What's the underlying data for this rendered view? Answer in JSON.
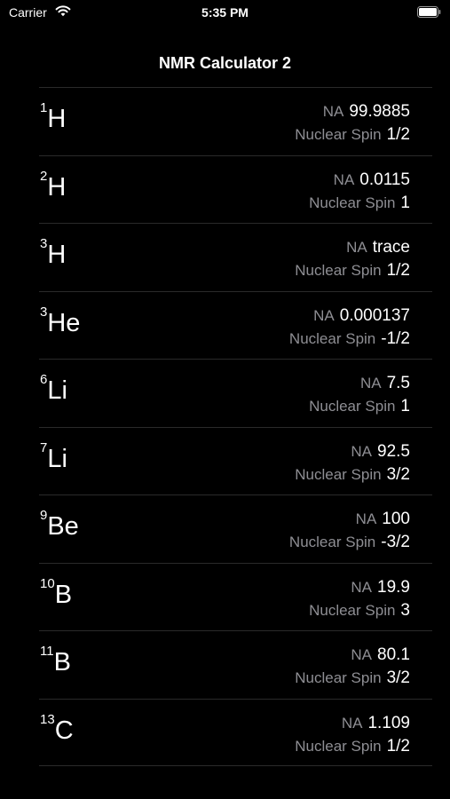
{
  "status_bar": {
    "carrier": "Carrier",
    "time": "5:35 PM",
    "wifi_icon": "wifi-icon",
    "battery_icon": "battery-icon"
  },
  "nav": {
    "title": "NMR Calculator 2"
  },
  "labels": {
    "na": "NA",
    "spin": "Nuclear Spin"
  },
  "isotopes": [
    {
      "mass": "1",
      "symbol": "H",
      "na": "99.9885",
      "spin": "1/2"
    },
    {
      "mass": "2",
      "symbol": "H",
      "na": "0.0115",
      "spin": "1"
    },
    {
      "mass": "3",
      "symbol": "H",
      "na": "trace",
      "spin": "1/2"
    },
    {
      "mass": "3",
      "symbol": "He",
      "na": "0.000137",
      "spin": "-1/2"
    },
    {
      "mass": "6",
      "symbol": "Li",
      "na": "7.5",
      "spin": "1"
    },
    {
      "mass": "7",
      "symbol": "Li",
      "na": "92.5",
      "spin": "3/2"
    },
    {
      "mass": "9",
      "symbol": "Be",
      "na": "100",
      "spin": "-3/2"
    },
    {
      "mass": "10",
      "symbol": "B",
      "na": "19.9",
      "spin": "3"
    },
    {
      "mass": "11",
      "symbol": "B",
      "na": "80.1",
      "spin": "3/2"
    },
    {
      "mass": "13",
      "symbol": "C",
      "na": "1.109",
      "spin": "1/2"
    }
  ]
}
